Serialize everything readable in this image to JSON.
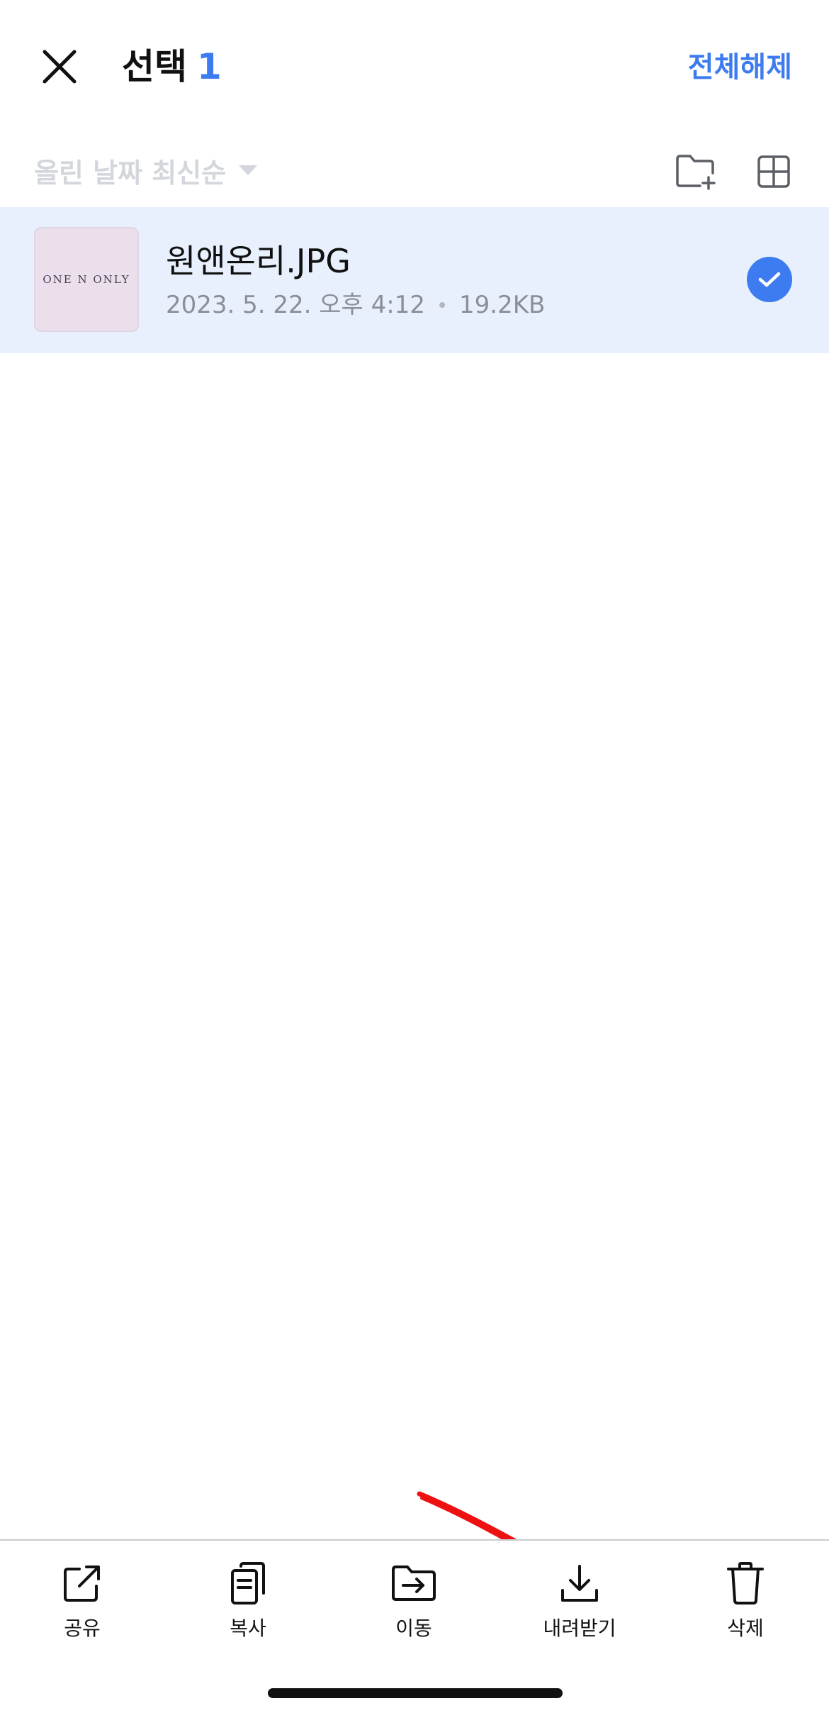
{
  "header": {
    "title": "선택",
    "selected_count": "1",
    "deselect_all_label": "전체해제",
    "close_icon": "close-icon"
  },
  "sortbar": {
    "sort_label": "올린 날짜 최신순",
    "icons": [
      "folder-plus-icon",
      "grid-view-icon"
    ]
  },
  "files": [
    {
      "name": "원앤온리.JPG",
      "date": "2023. 5. 22. 오후 4:12",
      "size": "19.2KB",
      "thumbnail_text": "ONE N ONLY",
      "selected": true
    }
  ],
  "toolbar": {
    "items": [
      {
        "label": "공유",
        "icon": "share-icon"
      },
      {
        "label": "복사",
        "icon": "copy-icon"
      },
      {
        "label": "이동",
        "icon": "move-folder-icon"
      },
      {
        "label": "내려받기",
        "icon": "download-icon"
      },
      {
        "label": "삭제",
        "icon": "trash-icon"
      }
    ]
  },
  "colors": {
    "accent": "#3d7cf0",
    "selected_row_bg": "#e9f0fd",
    "muted_text": "#8a8f98",
    "sort_text": "#d3d6dc",
    "annotation_arrow": "#ee1111"
  }
}
